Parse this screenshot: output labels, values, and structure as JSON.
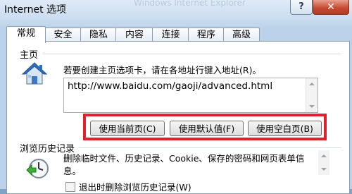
{
  "window": {
    "title": "Internet 选项",
    "ghost_title": "Windows Internet Explorer",
    "help_label": "?",
    "close_label": "✕"
  },
  "tabs": [
    {
      "label": "常规",
      "active": true
    },
    {
      "label": "安全"
    },
    {
      "label": "隐私"
    },
    {
      "label": "内容"
    },
    {
      "label": "连接"
    },
    {
      "label": "程序"
    },
    {
      "label": "高级"
    }
  ],
  "homepage": {
    "group_label": "主页",
    "hint": "若要创建主页选项卡，请在各地址行键入地址(R)。",
    "url": "http://www.baidu.com/gaoji/advanced.html",
    "icon": "house-icon",
    "buttons": {
      "use_current": "使用当前页(C)",
      "use_default": "使用默认值(F)",
      "use_blank": "使用空白页(B)"
    }
  },
  "history": {
    "group_label": "浏览历史记录",
    "description": "删除临时文件、历史记录、Cookie、保存的密码和网页表单信息。",
    "icon": "history-clock-icon",
    "delete_on_exit": "退出时删除浏览历史记录(W)"
  },
  "colors": {
    "highlight": "#e0202a",
    "close_button": "#c84b32"
  }
}
